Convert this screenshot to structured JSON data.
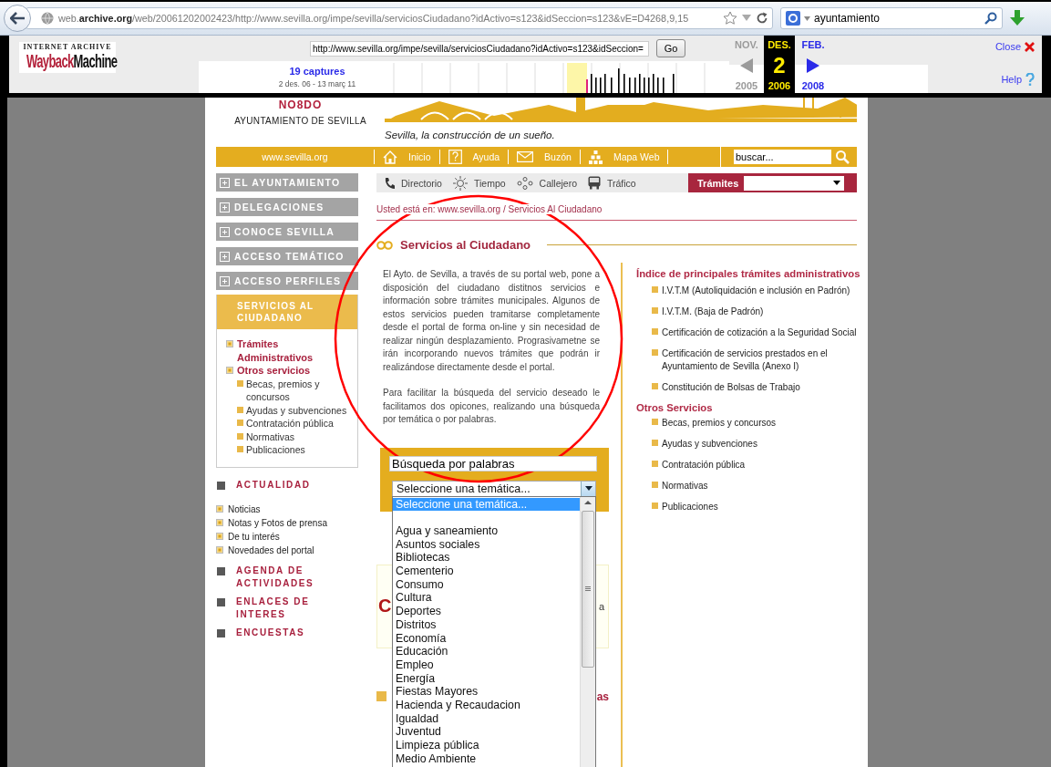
{
  "browser": {
    "url": "web.**archive.org**/web/20061202002423/http://www.sevilla.org/impe/sevilla/serviciosCiudadano?idActivo=s123&idSeccion=s123&vE=D4268,9,15",
    "search_value": "ayuntamiento"
  },
  "wayback": {
    "logo_caption": "INTERNET ARCHIVE",
    "logo_words": [
      "Wayback",
      "Machine"
    ],
    "url_value": "http://www.sevilla.org/impe/sevilla/serviciosCiudadano?idActivo=s123&idSeccion=",
    "go": "Go",
    "captures": "19 captures",
    "range": "2 des. 06 - 13 març 11",
    "months": [
      {
        "month": "NOV.",
        "year": "2005",
        "selected": false,
        "disabled": true
      },
      {
        "month": "DES.",
        "day": "2",
        "year": "2006",
        "selected": true,
        "disabled": false
      },
      {
        "month": "FEB.",
        "year": "2008",
        "selected": false,
        "disabled": false
      }
    ],
    "close": "Close",
    "help": "Help"
  },
  "site": {
    "header": {
      "emblem": "NO8DO",
      "name": "AYUNTAMIENTO DE SEVILLA",
      "tagline": "Sevilla, la construcción de un sueño."
    },
    "nav": {
      "home": "www.sevilla.org",
      "items": [
        "Inicio",
        "Ayuda",
        "Buzón",
        "Mapa Web"
      ],
      "search_placeholder": "buscar..."
    },
    "sidebar": {
      "menu": [
        {
          "label": "EL AYUNTAMIENTO",
          "expanded": false
        },
        {
          "label": "DELEGACIONES",
          "expanded": false
        },
        {
          "label": "CONOCE SEVILLA",
          "expanded": false
        },
        {
          "label": "ACCESO TEMÁTICO",
          "expanded": false
        },
        {
          "label": "ACCESO PERFILES",
          "expanded": false
        }
      ],
      "active_title": "SERVICIOS AL CIUDADANO",
      "active_items": [
        {
          "label": "Trámites Administrativos"
        },
        {
          "label": "Otros servicios",
          "children": [
            {
              "label": "Becas, premios y concursos"
            },
            {
              "label": "Ayudas y subvenciones"
            },
            {
              "label": "Contratación pública"
            },
            {
              "label": "Normativas"
            },
            {
              "label": "Publicaciones"
            }
          ]
        }
      ],
      "sections": [
        {
          "title": "ACTUALIDAD",
          "links": [
            "Noticias",
            "Notas y Fotos de prensa",
            "De tu interés",
            "Novedades del portal"
          ]
        },
        {
          "title": "AGENDA DE ACTIVIDADES"
        },
        {
          "title": "ENLACES DE INTERES"
        },
        {
          "title": "ENCUESTAS"
        }
      ]
    },
    "tools": [
      "Directorio",
      "Tiempo",
      "Callejero",
      "Tráfico"
    ],
    "tramites_label": "Trámites",
    "breadcrumb": "Usted está en: www.sevilla.org / Servicios Al Ciudadano",
    "heading": "Servicios al Ciudadano",
    "paragraphs": [
      "El Ayto. de Sevilla, a través de su portal web, pone a disposición del ciudadano distitnos servicios e información sobre trámites municipales. Algunos de estos servicios pueden tramitarse completamente desde el portal de forma on-line y sin necesidad de realizar ningún desplazamiento. Prograsivametne se irán incorporando nuevos trámites que podrán ir realizándose directamente desde el portal.",
      "Para facilitar la búsqueda del servicio deseado le facilitamos dos opicones, realizando una búsqueda por temática o por palabras."
    ],
    "search_panel": {
      "keyword_value": "Búsqueda por palabras",
      "select_value": "Seleccione una temática...",
      "expanded": true,
      "options": [
        {
          "label": "Seleccione una temática...",
          "selected": true
        },
        {
          "label": "Agua y saneamiento",
          "selected": false
        },
        {
          "label": "Asuntos sociales",
          "selected": false
        },
        {
          "label": "Bibliotecas",
          "selected": false
        },
        {
          "label": "Cementerio",
          "selected": false
        },
        {
          "label": "Consumo",
          "selected": false
        },
        {
          "label": "Cultura",
          "selected": false
        },
        {
          "label": "Deportes",
          "selected": false
        },
        {
          "label": "Distritos",
          "selected": false
        },
        {
          "label": "Economía",
          "selected": false
        },
        {
          "label": "Educación",
          "selected": false
        },
        {
          "label": "Empleo",
          "selected": false
        },
        {
          "label": "Energía",
          "selected": false
        },
        {
          "label": "Fiestas Mayores",
          "selected": false
        },
        {
          "label": "Hacienda y Recaudacion",
          "selected": false
        },
        {
          "label": "Igualdad",
          "selected": false
        },
        {
          "label": "Juventud",
          "selected": false
        },
        {
          "label": "Limpieza pública",
          "selected": false
        },
        {
          "label": "Medio Ambiente",
          "selected": false
        }
      ]
    },
    "covered": {
      "banner_mark": "C",
      "banner_text": "a",
      "link_text": "as"
    },
    "right_sections": [
      {
        "title": "Índice de principales trámites administrativos",
        "items": [
          "I.V.T.M (Autoliquidación e inclusión en Padrón)",
          "I.V.T.M. (Baja de Padrón)",
          "Certificación de cotización a la Seguridad Social",
          "Certificación de servicios prestados en el Ayuntamiento de Sevilla (Anexo I)",
          "Constitución de Bolsas de Trabajo"
        ]
      },
      {
        "title": "Otros Servicios",
        "items": [
          "Becas, premios y concursos",
          "Ayudas y subvenciones",
          "Contratación pública",
          "Normativas",
          "Publicaciones"
        ]
      }
    ]
  }
}
